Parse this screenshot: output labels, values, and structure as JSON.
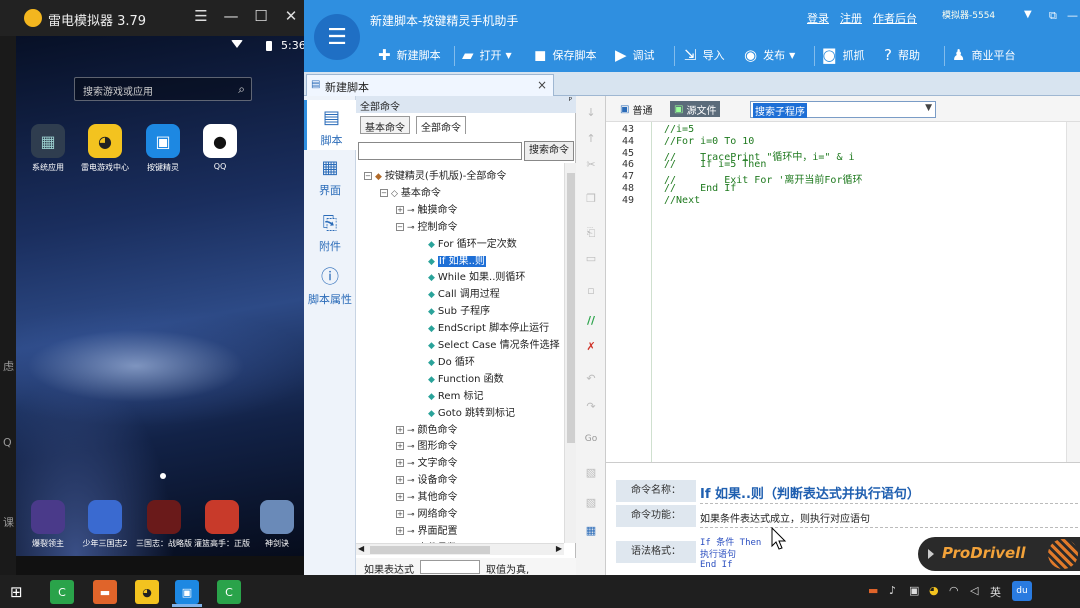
{
  "emulator": {
    "title": "雷电模拟器 3.79",
    "controls": {
      "menu": "☰",
      "minimize": "—",
      "maximize": "☐",
      "close": "✕"
    },
    "clock": "5:36",
    "search_placeholder": "搜索游戏或应用",
    "apps": [
      {
        "label": "系统应用",
        "icon": "grid-icon",
        "color": "#2f3d4f"
      },
      {
        "label": "雷电游戏中心",
        "icon": "gamepad-icon",
        "color": "#f3c31f"
      },
      {
        "label": "按键精灵",
        "icon": "robot-icon",
        "color": "#1d88e2"
      },
      {
        "label": "QQ",
        "icon": "qq-penguin-icon",
        "color": "#ffffff"
      }
    ],
    "dock": [
      {
        "label": "爆裂领主",
        "color": "#4a3a8a"
      },
      {
        "label": "少年三国志2",
        "color": "#3a6ad0"
      },
      {
        "label": "三国志：战略版",
        "color": "#6a1a1a"
      },
      {
        "label": "灌篮高手：正版",
        "color": "#c83a2a"
      },
      {
        "label": "神剑诀",
        "color": "#6a8ab8"
      }
    ],
    "left_strip_chars": [
      "虑",
      "Q",
      "课"
    ]
  },
  "app": {
    "title": "新建脚本-按键精灵手机助手",
    "header_links": [
      "登录",
      "注册",
      "作者后台"
    ],
    "emulator_select": "模拟器-5554",
    "window_controls": [
      "⧉",
      "—",
      "✕"
    ],
    "toolbar": [
      {
        "label": "新建脚本",
        "icon": "plus-icon"
      },
      {
        "label": "打开",
        "icon": "folder-icon",
        "dropdown": true
      },
      {
        "label": "保存脚本",
        "icon": "save-icon"
      },
      {
        "label": "调试",
        "icon": "play-icon"
      },
      {
        "label": "导入",
        "icon": "import-icon"
      },
      {
        "label": "发布",
        "icon": "publish-icon",
        "dropdown": true
      },
      {
        "label": "抓抓",
        "icon": "camera-icon"
      },
      {
        "label": "帮助",
        "icon": "help-icon"
      },
      {
        "label": "商业平台",
        "icon": "bag-icon"
      }
    ],
    "tab": {
      "label": "新建脚本",
      "close": "×"
    },
    "nav": [
      {
        "label": "脚本",
        "icon": "script-icon"
      },
      {
        "label": "界面",
        "icon": "layout-icon"
      },
      {
        "label": "附件",
        "icon": "paperclip-icon"
      },
      {
        "label": "脚本属性",
        "icon": "info-icon"
      }
    ],
    "commands": {
      "title": "全部命令",
      "tabs": [
        "基本命令",
        "全部命令"
      ],
      "search_button": "搜索命令",
      "tree": [
        {
          "label": "按键精灵(手机版)-全部命令",
          "level": 0,
          "type": "root"
        },
        {
          "label": "基本命令",
          "level": 1,
          "type": "group"
        },
        {
          "label": "触摸命令",
          "level": 2,
          "type": "cat",
          "exp": "+"
        },
        {
          "label": "控制命令",
          "level": 2,
          "type": "cat",
          "exp": "-"
        },
        {
          "label": "For 循环一定次数",
          "level": 3,
          "type": "cmd"
        },
        {
          "label": "If 如果..则",
          "level": 3,
          "type": "cmd",
          "selected": true
        },
        {
          "label": "While 如果..则循环",
          "level": 3,
          "type": "cmd"
        },
        {
          "label": "Call 调用过程",
          "level": 3,
          "type": "cmd"
        },
        {
          "label": "Sub 子程序",
          "level": 3,
          "type": "cmd"
        },
        {
          "label": "EndScript 脚本停止运行",
          "level": 3,
          "type": "cmd"
        },
        {
          "label": "Select Case 情况条件选择",
          "level": 3,
          "type": "cmd"
        },
        {
          "label": "Do 循环",
          "level": 3,
          "type": "cmd"
        },
        {
          "label": "Function 函数",
          "level": 3,
          "type": "cmd"
        },
        {
          "label": "Rem 标记",
          "level": 3,
          "type": "cmd"
        },
        {
          "label": "Goto 跳转到标记",
          "level": 3,
          "type": "cmd"
        },
        {
          "label": "颜色命令",
          "level": 2,
          "type": "cat",
          "exp": "+"
        },
        {
          "label": "图形命令",
          "level": 2,
          "type": "cat",
          "exp": "+"
        },
        {
          "label": "文字命令",
          "level": 2,
          "type": "cat",
          "exp": "+"
        },
        {
          "label": "设备命令",
          "level": 2,
          "type": "cat",
          "exp": "+"
        },
        {
          "label": "其他命令",
          "level": 2,
          "type": "cat",
          "exp": "+"
        },
        {
          "label": "网络命令",
          "level": 2,
          "type": "cat",
          "exp": "+"
        },
        {
          "label": "界面配置",
          "level": 2,
          "type": "cat",
          "exp": "+"
        },
        {
          "label": "事件函数",
          "level": 2,
          "type": "cat",
          "exp": "+"
        }
      ],
      "bottom_label": "如果表达式",
      "bottom_label2": "取值为真,"
    },
    "editor": {
      "mode_normal": "普通",
      "mode_source": "源文件",
      "sub_select": "搜索子程序",
      "lines": [
        {
          "n": "43",
          "code": "//i=5"
        },
        {
          "n": "44",
          "code": "//For i=0 To 10"
        },
        {
          "n": "45",
          "code": "//    TracePrint \"循环中，i=\" & i"
        },
        {
          "n": "46",
          "code": "//    If i=5 Then"
        },
        {
          "n": "47",
          "code": "//        Exit For '离开当前For循环"
        },
        {
          "n": "48",
          "code": "//    End If"
        },
        {
          "n": "49",
          "code": "//Next"
        }
      ]
    },
    "help": {
      "name_label": "命令名称：",
      "name_value": "If 如果..则（判断表达式并执行语句）",
      "func_label": "命令功能：",
      "func_value": "如果条件表达式成立，则执行对应语句",
      "syntax_label": "语法格式：",
      "syntax_lines": [
        "If 条件  Then",
        "执行语句",
        "End If"
      ]
    }
  },
  "overlay": {
    "brand": "ProDrivell"
  },
  "taskbar": {
    "tray": [
      "英"
    ],
    "apps": [
      {
        "icon": "windows-icon"
      },
      {
        "icon": "camtasia-icon",
        "color": "#2aa34a"
      },
      {
        "icon": "media-icon",
        "color": "#e0642a"
      },
      {
        "icon": "leidian-icon",
        "color": "#f3c31f"
      },
      {
        "icon": "anjian-icon",
        "color": "#1d88e2"
      },
      {
        "icon": "camtasia2-icon",
        "color": "#2aa34a"
      }
    ]
  }
}
